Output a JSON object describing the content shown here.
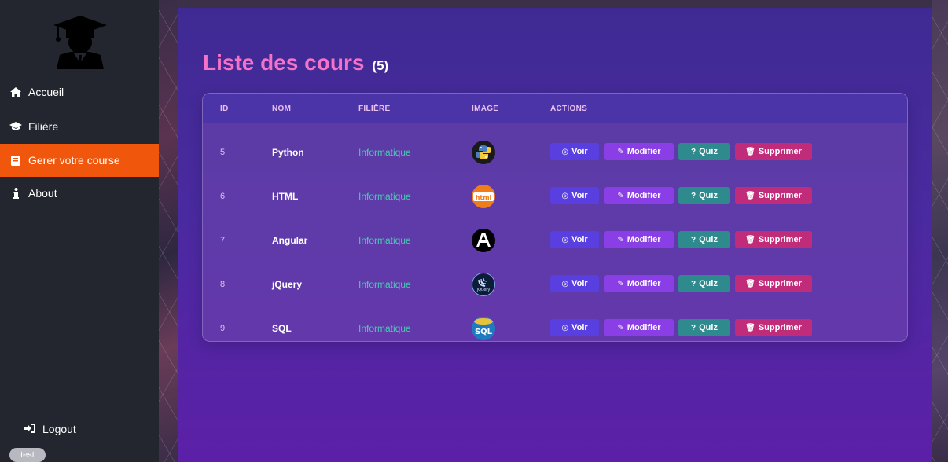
{
  "sidebar": {
    "items": [
      {
        "label": "Accueil",
        "icon": "home-icon"
      },
      {
        "label": "Filière",
        "icon": "graduation-cap-icon"
      },
      {
        "label": "Gerer votre course",
        "icon": "book-icon"
      },
      {
        "label": "About",
        "icon": "info-icon"
      }
    ],
    "active_index": 2,
    "logout_label": "Logout",
    "user": "test"
  },
  "main": {
    "title": "Liste des cours",
    "count": "(5)",
    "table": {
      "headers": [
        "ID",
        "NOM",
        "FILIÈRE",
        "IMAGE",
        "ACTIONS"
      ],
      "rows": [
        {
          "id": "5",
          "nom": "Python",
          "filiere": "Informatique",
          "image": "python-logo-icon"
        },
        {
          "id": "6",
          "nom": "HTML",
          "filiere": "Informatique",
          "image": "html-logo-icon"
        },
        {
          "id": "7",
          "nom": "Angular",
          "filiere": "Informatique",
          "image": "angular-logo-icon"
        },
        {
          "id": "8",
          "nom": "jQuery",
          "filiere": "Informatique",
          "image": "jquery-logo-icon"
        },
        {
          "id": "9",
          "nom": "SQL",
          "filiere": "Informatique",
          "image": "sql-logo-icon"
        }
      ],
      "actions": {
        "voir": "Voir",
        "modifier": "Modifier",
        "quiz": "Quiz",
        "supprimer": "Supprimer"
      }
    }
  },
  "colors": {
    "sidebar_bg": "#23262e",
    "active_item": "#f0570c",
    "title": "#f472c8",
    "filiere_text": "#4cc7b4",
    "btn_voir": "#5a3fe0",
    "btn_modifier": "#8a3fe6",
    "btn_quiz": "#2f8a8e",
    "btn_supprimer": "#c02b7a"
  }
}
